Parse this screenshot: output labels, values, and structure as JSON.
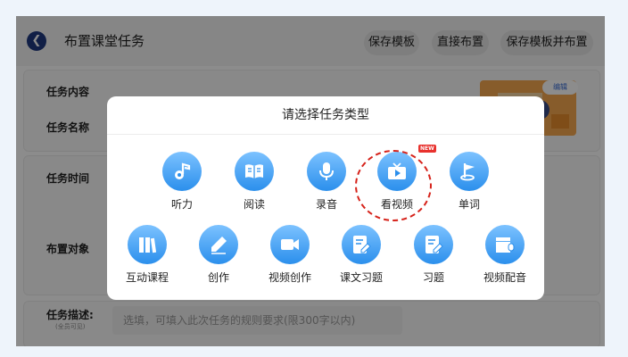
{
  "header": {
    "title": "布置课堂任务",
    "buttons": [
      "保存模板",
      "直接布置",
      "保存模板并布置"
    ]
  },
  "form": {
    "labels": {
      "task_content": "任务内容",
      "task_name": "任务名称",
      "task_time": "任务时间",
      "assign_target": "布置对象",
      "task_desc": "任务描述:",
      "desc_note": "(全员可见)"
    },
    "desc_placeholder": "选填，可填入此次任务的规则要求(限300字以内)",
    "edit_tag": "编辑"
  },
  "modal": {
    "title": "请选择任务类型",
    "new_badge": "NEW",
    "row1": [
      {
        "label": "听力",
        "icon": "headphone-note-icon"
      },
      {
        "label": "阅读",
        "icon": "book-icon"
      },
      {
        "label": "录音",
        "icon": "microphone-icon"
      },
      {
        "label": "看视频",
        "icon": "tv-play-icon"
      },
      {
        "label": "单词",
        "icon": "flag-icon"
      }
    ],
    "row2": [
      {
        "label": "互动课程",
        "icon": "books-icon"
      },
      {
        "label": "创作",
        "icon": "pencil-icon"
      },
      {
        "label": "视频创作",
        "icon": "video-camera-icon"
      },
      {
        "label": "课文习题",
        "icon": "doc-edit-icon"
      },
      {
        "label": "习题",
        "icon": "doc-edit-icon"
      },
      {
        "label": "视频配音",
        "icon": "clapper-mic-icon"
      }
    ]
  },
  "colors": {
    "accent": "#2b8fec",
    "dark_blue": "#203a80",
    "highlight": "#d6221a"
  }
}
